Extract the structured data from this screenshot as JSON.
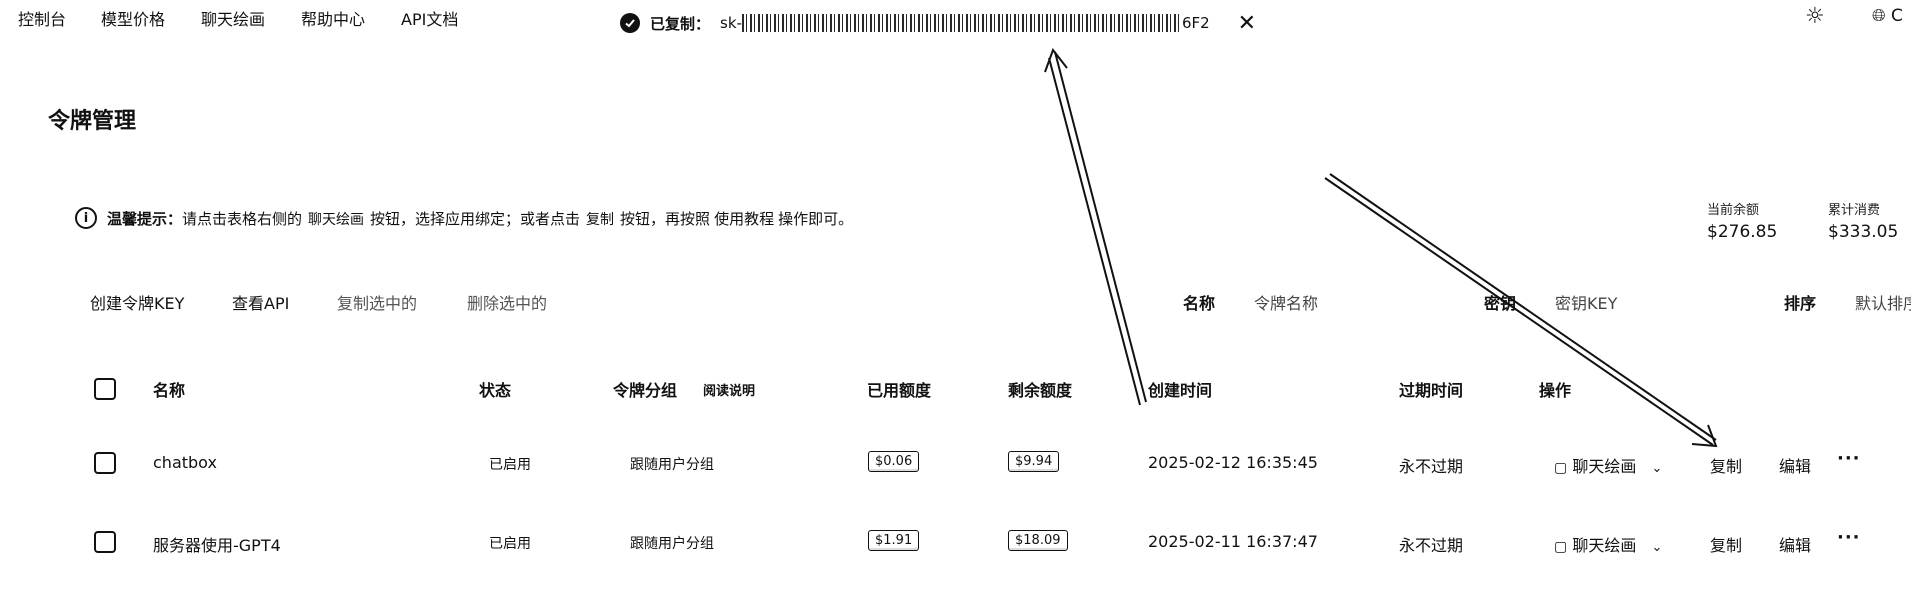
{
  "nav": {
    "items": [
      "控制台",
      "模型价格",
      "聊天绘画",
      "帮助中心",
      "API文档"
    ],
    "language_label": "C"
  },
  "toast": {
    "copied_label": "已复制：",
    "key_prefix": "sk-",
    "key_suffix": "6F2"
  },
  "page": {
    "title": "令牌管理"
  },
  "tip": {
    "label": "温馨提示：",
    "text_1": "请点击表格右侧的",
    "chip_chat": "聊天绘画",
    "text_2": "按钮，选择应用绑定；或者点击",
    "chip_copy": "复制",
    "text_3": "按钮，再按照",
    "link_tutorial": "使用教程",
    "text_4": "操作即可。"
  },
  "stats": {
    "balance_label": "当前余额",
    "balance_value": "$276.85",
    "spent_label": "累计消费",
    "spent_value": "$333.05"
  },
  "toolbar": {
    "create": "创建令牌KEY",
    "view_api": "查看API",
    "copy_selected": "复制选中的",
    "delete_selected": "删除选中的"
  },
  "filters": {
    "name_label": "名称",
    "name_placeholder": "令牌名称",
    "key_label": "密钥",
    "key_placeholder": "密钥KEY",
    "sort_label": "排序",
    "sort_value": "默认排序"
  },
  "table": {
    "headers": {
      "name": "名称",
      "status": "状态",
      "group": "令牌分组",
      "group_help": "阅读说明",
      "used": "已用额度",
      "remaining": "剩余额度",
      "created": "创建时间",
      "expires": "过期时间",
      "actions": "操作"
    },
    "rows": [
      {
        "name": "chatbox",
        "status": "已启用",
        "group": "跟随用户分组",
        "used": "$0.06",
        "remaining": "$9.94",
        "created": "2025-02-12 16:35:45",
        "expires": "永不过期",
        "chat_action": "聊天绘画",
        "copy_action": "复制",
        "edit_action": "编辑",
        "more": "···"
      },
      {
        "name": "服务器使用-GPT4",
        "status": "已启用",
        "group": "跟随用户分组",
        "used": "$1.91",
        "remaining": "$18.09",
        "created": "2025-02-11 16:37:47",
        "expires": "永不过期",
        "chat_action": "聊天绘画",
        "copy_action": "复制",
        "edit_action": "编辑",
        "more": "···"
      }
    ]
  },
  "colors": {
    "text": "#111111",
    "muted": "#555555",
    "background": "#ffffff"
  }
}
